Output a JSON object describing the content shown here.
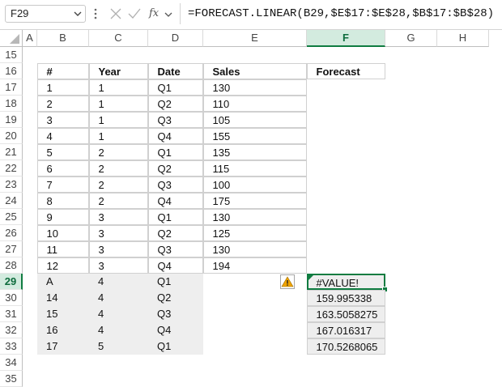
{
  "formula_bar": {
    "name_box": "F29",
    "fx_label": "fx",
    "formula": "=FORECAST.LINEAR(B29,$E$17:$E$28,$B$17:$B$28)"
  },
  "columns": [
    "A",
    "B",
    "C",
    "D",
    "E",
    "F",
    "G",
    "H"
  ],
  "selected_column": "F",
  "rows": [
    "15",
    "16",
    "17",
    "18",
    "19",
    "20",
    "21",
    "22",
    "23",
    "24",
    "25",
    "26",
    "27",
    "28",
    "29",
    "30",
    "31",
    "32",
    "33",
    "34",
    "35"
  ],
  "selected_row": "29",
  "table": {
    "headers": [
      "#",
      "Year",
      "Date",
      "Sales"
    ],
    "forecast_header": "Forecast",
    "data": [
      [
        "1",
        "1",
        "Q1",
        "130"
      ],
      [
        "2",
        "1",
        "Q2",
        "110"
      ],
      [
        "3",
        "1",
        "Q3",
        "105"
      ],
      [
        "4",
        "1",
        "Q4",
        "155"
      ],
      [
        "5",
        "2",
        "Q1",
        "135"
      ],
      [
        "6",
        "2",
        "Q2",
        "115"
      ],
      [
        "7",
        "2",
        "Q3",
        "100"
      ],
      [
        "8",
        "2",
        "Q4",
        "175"
      ],
      [
        "9",
        "3",
        "Q1",
        "130"
      ],
      [
        "10",
        "3",
        "Q2",
        "125"
      ],
      [
        "11",
        "3",
        "Q3",
        "130"
      ],
      [
        "12",
        "3",
        "Q4",
        "194"
      ]
    ],
    "forecast_rows": [
      [
        "A",
        "4",
        "Q1",
        "#VALUE!"
      ],
      [
        "14",
        "4",
        "Q2",
        "159.995338"
      ],
      [
        "15",
        "4",
        "Q3",
        "163.5058275"
      ],
      [
        "16",
        "4",
        "Q4",
        "167.016317"
      ],
      [
        "17",
        "5",
        "Q1",
        "170.5268065"
      ]
    ]
  },
  "colors": {
    "accent": "#107c41",
    "selected_header_bg": "#d3ebdf",
    "gray_cell": "#eeeeee",
    "warning": "#f0a400"
  },
  "icons": {
    "cancel": "x-icon",
    "enter": "checkmark-icon",
    "function": "fx-icon",
    "error_warning": "warning-icon"
  }
}
